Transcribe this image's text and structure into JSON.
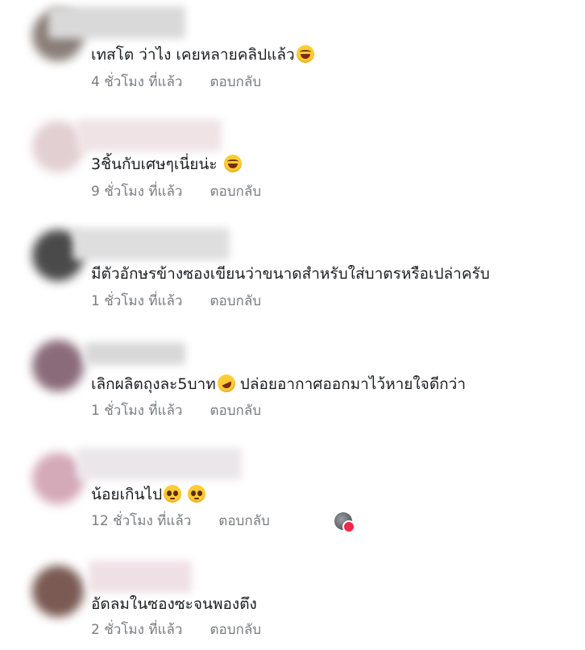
{
  "comments": [
    {
      "text": "เทสโต ว่าไง เคยหลายคลิปแล้ว",
      "emoji": "laugh",
      "time": "4 ชั่วโมง ที่แล้ว",
      "reply": "ตอบกลับ"
    },
    {
      "text": "3ชิ้นกับเศษๆเนี่ยน่ะ ",
      "emoji": "laugh",
      "time": "9 ชั่วโมง ที่แล้ว",
      "reply": "ตอบกลับ"
    },
    {
      "text": "มีตัวอักษรข้างซองเขียนว่าขนาดสำหรับใส่บาตรหรือเปล่าครับ",
      "emoji": "",
      "time": "1 ชั่วโมง ที่แล้ว",
      "reply": "ตอบกลับ"
    },
    {
      "text_a": "เลิกผลิตถุงละ5บาท",
      "emoji": "rofl",
      "text_b": " ปล่อยอากาศออกมาไว้หายใจดีกว่า",
      "time": "1 ชั่วโมง ที่แล้ว",
      "reply": "ตอบกลับ"
    },
    {
      "text": "น้อยเกินไป",
      "emoji": "plead",
      "time": "12 ชั่วโมง ที่แล้ว",
      "reply": "ตอบกลับ"
    },
    {
      "text": "อัดลมในซองซะจนพองตึง",
      "emoji": "",
      "time": "2 ชั่วโมง ที่แล้ว",
      "reply": "ตอบกลับ"
    }
  ],
  "colors": {
    "text": "#1c1e21",
    "meta": "#7a7c80",
    "heart": "#f0284a"
  }
}
